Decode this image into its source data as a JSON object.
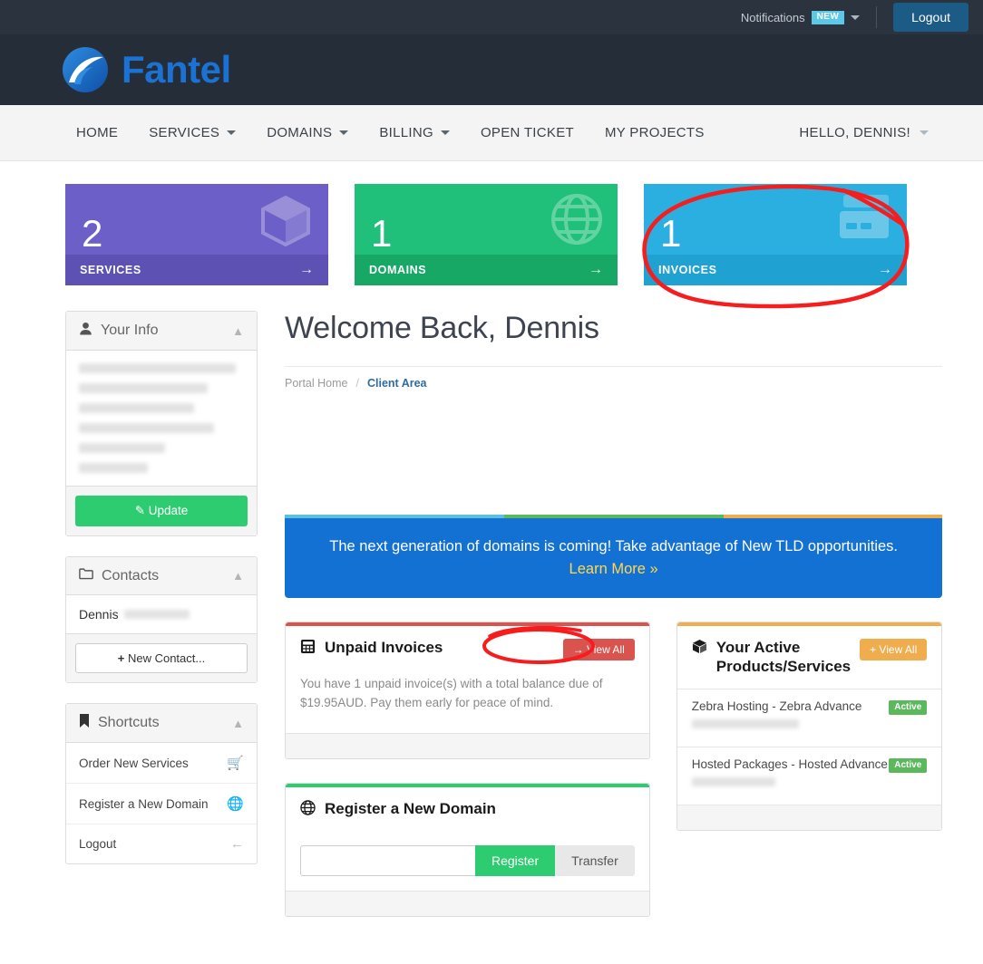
{
  "topbar": {
    "notifications_label": "Notifications",
    "new_badge": "NEW",
    "logout_label": "Logout"
  },
  "brand": {
    "name": "Fantel",
    "logo_icon": "fantel-swoosh-logo",
    "accent": "#1a73d4"
  },
  "nav": {
    "items": [
      {
        "label": "HOME",
        "has_caret": false
      },
      {
        "label": "SERVICES",
        "has_caret": true
      },
      {
        "label": "DOMAINS",
        "has_caret": true
      },
      {
        "label": "BILLING",
        "has_caret": true
      },
      {
        "label": "OPEN TICKET",
        "has_caret": false
      },
      {
        "label": "MY PROJECTS",
        "has_caret": false
      }
    ],
    "user_menu": "HELLO, DENNIS!"
  },
  "stats": [
    {
      "count": "2",
      "label": "SERVICES",
      "icon": "cube-icon",
      "color": "#6c5fc7",
      "footer_color": "#5d51b4",
      "arrow": "→"
    },
    {
      "count": "1",
      "label": "DOMAINS",
      "icon": "globe-icon",
      "color": "#21c07a",
      "footer_color": "#17a866",
      "arrow": "→"
    },
    {
      "count": "1",
      "label": "INVOICES",
      "icon": "invoice-card-icon",
      "color": "#2bafe0",
      "footer_color": "#1fa1d2",
      "arrow": "→"
    }
  ],
  "sidebar": {
    "your_info": {
      "title": "Your Info",
      "icon": "user-icon",
      "collapse_icon": "chevron-up-icon",
      "address_redacted_lines": 6,
      "update_label": "Update",
      "update_icon": "pencil-icon"
    },
    "contacts": {
      "title": "Contacts",
      "icon": "folder-icon",
      "collapse_icon": "chevron-up-icon",
      "contact_name": "Dennis",
      "contact_surname_redacted": true,
      "new_contact_label": "New Contact...",
      "new_contact_icon": "plus-icon"
    },
    "shortcuts": {
      "title": "Shortcuts",
      "icon": "bookmark-icon",
      "collapse_icon": "chevron-up-icon",
      "items": [
        {
          "label": "Order New Services",
          "icon": "cart-icon"
        },
        {
          "label": "Register a New Domain",
          "icon": "globe-icon"
        },
        {
          "label": "Logout",
          "icon": "arrow-left-icon"
        }
      ]
    }
  },
  "main": {
    "page_title": "Welcome Back, Dennis",
    "breadcrumb": {
      "home": "Portal Home",
      "separator": "/",
      "current": "Client Area"
    },
    "tricolor": [
      "#5bc0de",
      "#5cb85c",
      "#f0ad4e"
    ],
    "promo": {
      "text": "The next generation of domains is coming! Take advantage of New TLD opportunities.",
      "link": "Learn More »",
      "background": "#1471d4",
      "link_color": "#ffd84d"
    },
    "unpaid_invoices": {
      "title": "Unpaid Invoices",
      "icon": "invoice-icon",
      "accent": "#d9534f",
      "view_all_label": "→ View All",
      "body": "You have 1 unpaid invoice(s) with a total balance due of $19.95AUD. Pay them early for peace of mind."
    },
    "register_domain": {
      "title": "Register a New Domain",
      "icon": "globe-icon",
      "accent": "#2ecc71",
      "input_value": "",
      "input_placeholder": "",
      "register_label": "Register",
      "transfer_label": "Transfer"
    },
    "active_products": {
      "title": "Your Active Products/Services",
      "icon": "box-icon",
      "accent": "#f0ad4e",
      "view_all_label": "+ View All",
      "rows": [
        {
          "name": "Zebra Hosting - Zebra Advance",
          "domain_redacted": true,
          "status": "Active"
        },
        {
          "name": "Hosted Packages - Hosted Advance",
          "domain_redacted": true,
          "status": "Active"
        }
      ]
    }
  },
  "annotations": {
    "color": "#f51d1d",
    "shapes": [
      {
        "name": "circle-invoices-card",
        "type": "ellipse"
      },
      {
        "name": "circle-view-all-invoices",
        "type": "ellipse"
      }
    ]
  }
}
